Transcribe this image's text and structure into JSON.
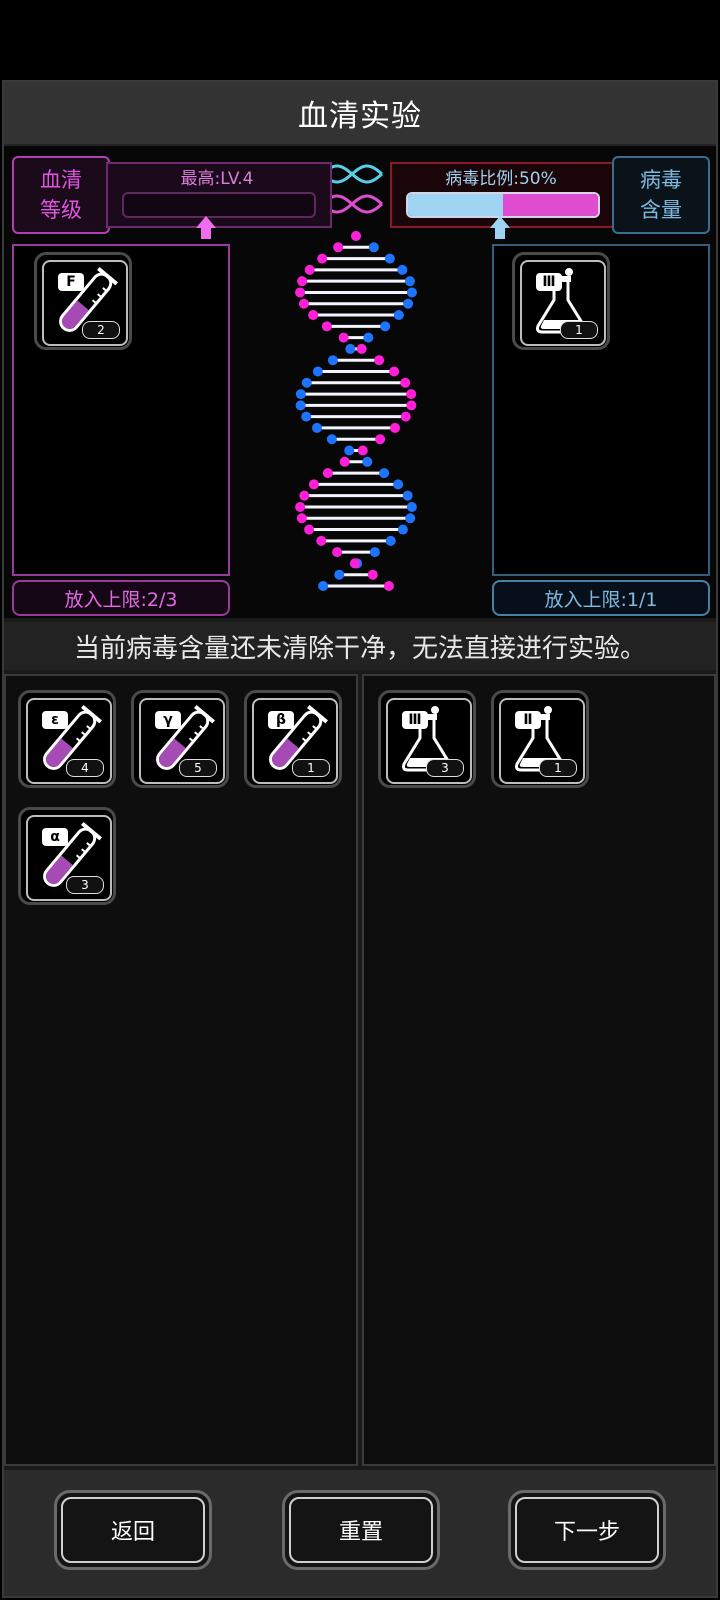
{
  "title": "血清实验",
  "serum": {
    "tag_line1": "血清",
    "tag_line2": "等级",
    "level_text": "最高:LV.4",
    "capacity_text": "放入上限:2/3",
    "color": "#e055e0",
    "slotted": [
      {
        "label": "F",
        "count": "2"
      }
    ]
  },
  "virus": {
    "tag_line1": "病毒",
    "tag_line2": "含量",
    "ratio_text": "病毒比例:50%",
    "ratio": 0.5,
    "capacity_text": "放入上限:1/1",
    "color": "#7fb8dd",
    "slotted": [
      {
        "label": "Ⅲ",
        "count": "1"
      }
    ]
  },
  "notice": "当前病毒含量还未清除干净，无法直接进行实验。",
  "inventory_serum": [
    {
      "label": "ε",
      "count": "4"
    },
    {
      "label": "γ",
      "count": "5"
    },
    {
      "label": "β",
      "count": "1"
    },
    {
      "label": "α",
      "count": "3"
    }
  ],
  "inventory_virus": [
    {
      "label": "Ⅲ",
      "count": "3"
    },
    {
      "label": "Ⅱ",
      "count": "1"
    }
  ],
  "buttons": {
    "back": "返回",
    "reset": "重置",
    "next": "下一步"
  }
}
